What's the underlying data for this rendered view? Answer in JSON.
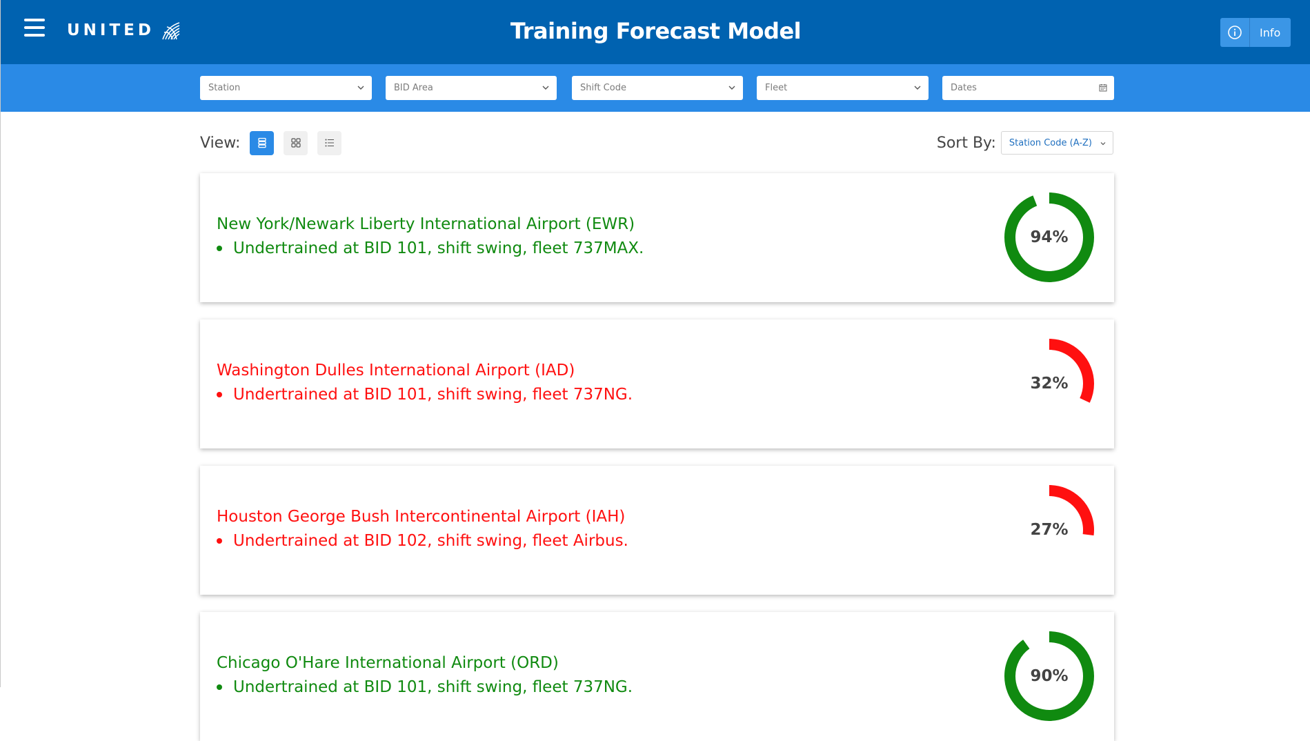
{
  "header": {
    "logo_text": "UNITED",
    "title": "Training Forecast Model",
    "info_label": "Info",
    "menu_icon": "hamburger-icon",
    "info_icon": "info-circle-icon",
    "color": "#0062b0"
  },
  "filters": {
    "color": "#2a8ae6",
    "items": [
      {
        "placeholder": "Station",
        "icon": "chevron-down-icon"
      },
      {
        "placeholder": "BID Area",
        "icon": "chevron-down-icon"
      },
      {
        "placeholder": "Shift Code",
        "icon": "chevron-down-icon"
      },
      {
        "placeholder": "Fleet",
        "icon": "chevron-down-icon"
      },
      {
        "placeholder": "Dates",
        "icon": "calendar-icon"
      }
    ]
  },
  "view": {
    "label": "View:",
    "options": [
      "list-view-icon",
      "grid-view-icon",
      "bullet-list-icon"
    ],
    "active": "list-view-icon"
  },
  "sort": {
    "label": "Sort By:",
    "value": "Station Code (A-Z)"
  },
  "colors": {
    "good": "#108a10",
    "bad": "#ff1010"
  },
  "stations": [
    {
      "name": "New York/Newark Liberty International Airport (EWR)",
      "issue": "Undertrained at BID 101, shift swing, fleet 737MAX.",
      "percent": 94,
      "percent_label": "94%",
      "status": "good"
    },
    {
      "name": "Washington Dulles International Airport (IAD)",
      "issue": "Undertrained at BID 101, shift swing, fleet 737NG.",
      "percent": 32,
      "percent_label": "32%",
      "status": "bad"
    },
    {
      "name": "Houston George Bush Intercontinental Airport (IAH)",
      "issue": "Undertrained at BID 102, shift swing, fleet Airbus.",
      "percent": 27,
      "percent_label": "27%",
      "status": "bad"
    },
    {
      "name": "Chicago O'Hare International Airport (ORD)",
      "issue": "Undertrained at BID 101, shift swing, fleet 737NG.",
      "percent": 90,
      "percent_label": "90%",
      "status": "good"
    }
  ]
}
